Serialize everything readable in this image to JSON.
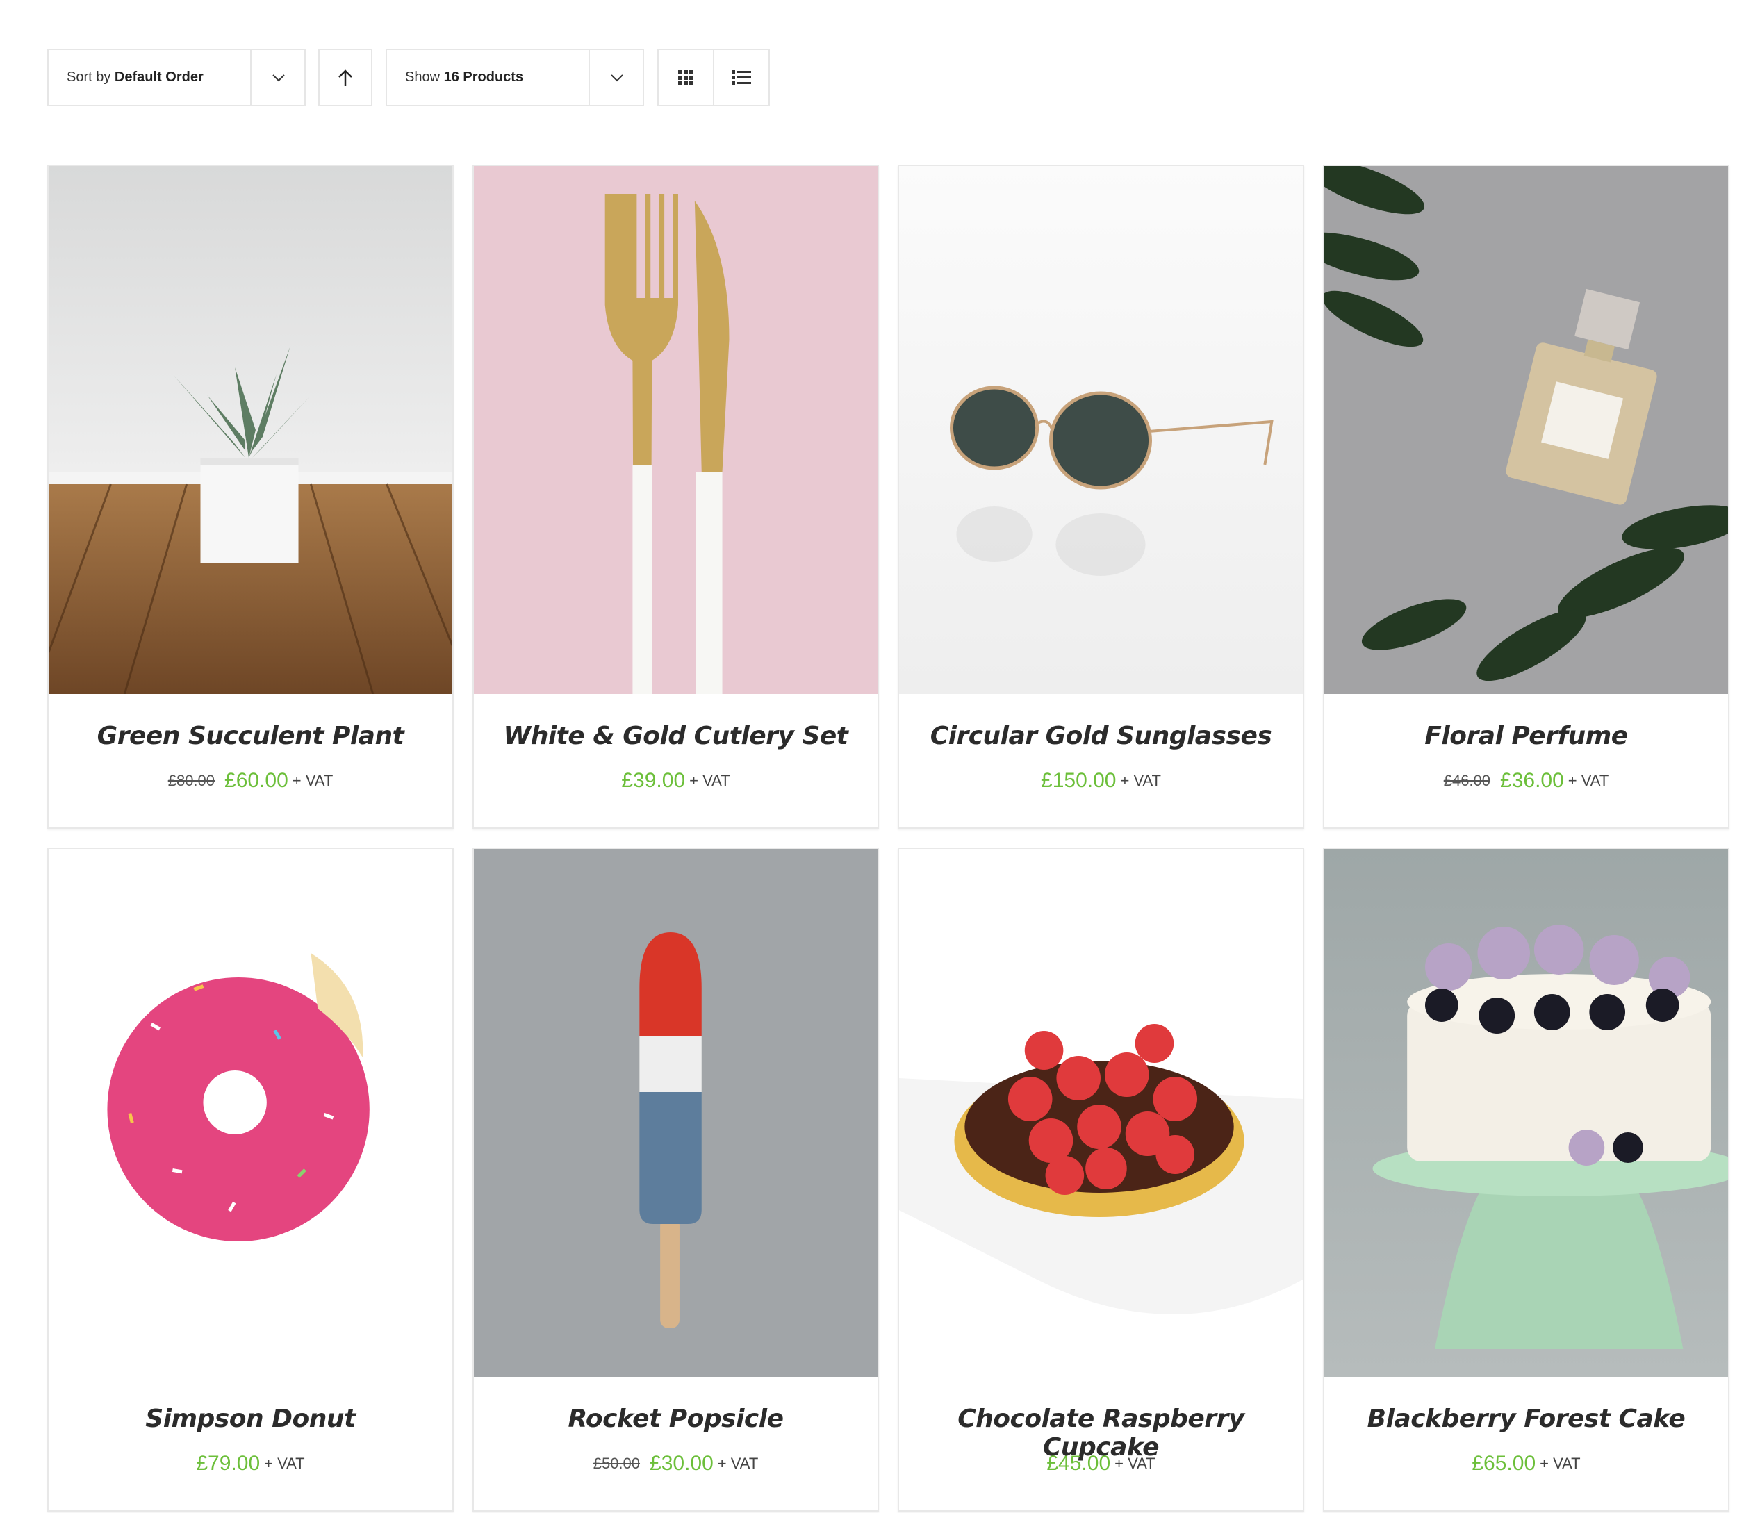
{
  "toolbar": {
    "sort_prefix": "Sort by",
    "sort_value": "Default Order",
    "show_prefix": "Show",
    "show_value": "16 Products",
    "icons": {
      "sort_caret": "chevron-down-icon",
      "sort_direction": "arrow-up-icon",
      "show_caret": "chevron-down-icon",
      "grid_view": "grid-icon",
      "list_view": "list-icon"
    }
  },
  "products": [
    {
      "name": "Green Succulent Plant",
      "old_price": "£80.00",
      "price": "£60.00",
      "vat": "+ VAT"
    },
    {
      "name": "White & Gold Cutlery Set",
      "old_price": "",
      "price": "£39.00",
      "vat": "+ VAT"
    },
    {
      "name": "Circular Gold Sunglasses",
      "old_price": "",
      "price": "£150.00",
      "vat": "+ VAT"
    },
    {
      "name": "Floral Perfume",
      "old_price": "£46.00",
      "price": "£36.00",
      "vat": "+ VAT"
    },
    {
      "name": "Simpson Donut",
      "old_price": "",
      "price": "£79.00",
      "vat": "+ VAT"
    },
    {
      "name": "Rocket Popsicle",
      "old_price": "£50.00",
      "price": "£30.00",
      "vat": "+ VAT"
    },
    {
      "name": "Chocolate Raspberry Cupcake",
      "old_price": "",
      "price": "£45.00",
      "vat": "+ VAT"
    },
    {
      "name": "Blackberry Forest Cake",
      "old_price": "",
      "price": "£65.00",
      "vat": "+ VAT"
    }
  ],
  "colors": {
    "price_green": "#6cbf3a",
    "border": "#e6e6e6",
    "title": "#2b2b2b"
  }
}
